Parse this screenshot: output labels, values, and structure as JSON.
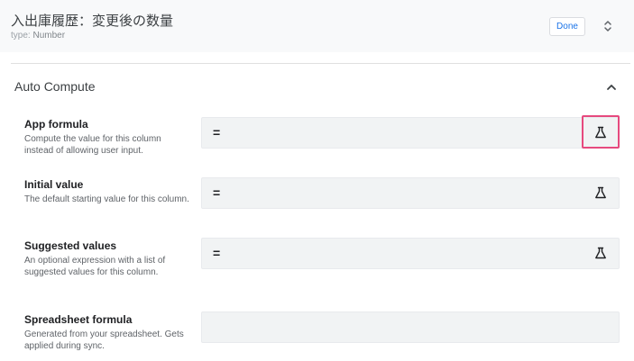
{
  "column": {
    "title": "入出庫履歴：変更後の数量",
    "type_key": "type:",
    "type_value": "Number"
  },
  "header": {
    "done_label": "Done",
    "expand_icon": "unfold-icon"
  },
  "section": {
    "title": "Auto Compute",
    "collapse_icon": "chevron-up-icon"
  },
  "fields": [
    {
      "label": "App formula",
      "description": "Compute the value for this column instead of allowing user input.",
      "value": "=",
      "icon": "flask-icon",
      "highlighted": true
    },
    {
      "label": "Initial value",
      "description": "The default starting value for this column.",
      "value": "=",
      "icon": "flask-icon",
      "highlighted": false
    },
    {
      "label": "Suggested values",
      "description": "An optional expression with a list of suggested values for this column.",
      "value": "=",
      "icon": "flask-icon",
      "highlighted": false
    },
    {
      "label": "Spreadsheet formula",
      "description": "Generated from your spreadsheet. Gets applied during sync.",
      "value": ""
    }
  ],
  "colors": {
    "highlight_border": "#e6497e",
    "done_text": "#1a73e8",
    "input_bg": "#f1f3f4"
  }
}
